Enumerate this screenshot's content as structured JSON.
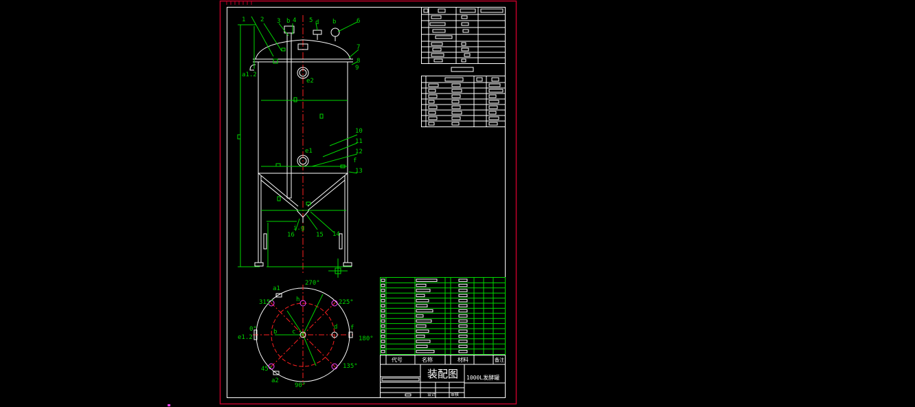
{
  "colors": {
    "background": "#000000",
    "frame_outer": "#c0002a",
    "frame_inner": "#ffffff",
    "dimension": "#00d800",
    "centerline": "#ff2020",
    "part": "#ffffff",
    "nozzle_ring": "#ff40ff"
  },
  "elevation_view": {
    "callouts": [
      "1",
      "2",
      "3",
      "b",
      "4",
      "5",
      "d",
      "b",
      "6",
      "7",
      "8",
      "9",
      "10",
      "11",
      "12",
      "f",
      "13",
      "14",
      "15",
      "16",
      "a1.2",
      "e2",
      "e1",
      "i.g"
    ]
  },
  "plan_view": {
    "angles": [
      "270°",
      "225°",
      "180°",
      "135°",
      "90°",
      "45°",
      "0°",
      "315°"
    ],
    "nozzles": [
      "a1",
      "a2",
      "e1.2",
      "b",
      "c",
      "d",
      "f",
      "h"
    ]
  },
  "title_block": {
    "drawing_title": "装配图",
    "product_name": "1000L发酵罐",
    "col_seq": "代号",
    "col_name": "名称",
    "col_material": "材料",
    "col_remark": "备注",
    "col_scale": "比例",
    "col_drawn": "设计",
    "col_checked": "审核"
  }
}
